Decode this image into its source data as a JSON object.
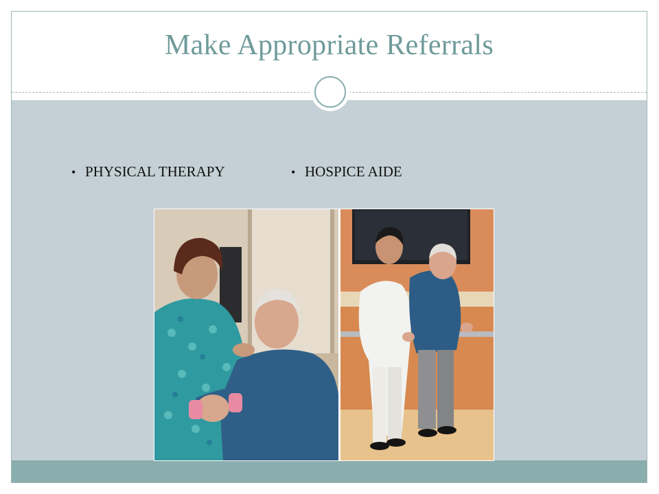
{
  "slide": {
    "title": "Make Appropriate Referrals",
    "bullets": [
      {
        "label": "PHYSICAL THERAPY"
      },
      {
        "label": "HOSPICE AIDE"
      }
    ],
    "bullet_glyph": "•"
  },
  "photo": {
    "left_panel": "therapist assisting patient with hand weight",
    "right_panel": "aide assisting patient walking along handrail"
  },
  "colors": {
    "title": "#6f9a9a",
    "content_band": "#c5d0d6",
    "footer_band": "#8aadad",
    "frame_border": "#9fb3b3"
  }
}
